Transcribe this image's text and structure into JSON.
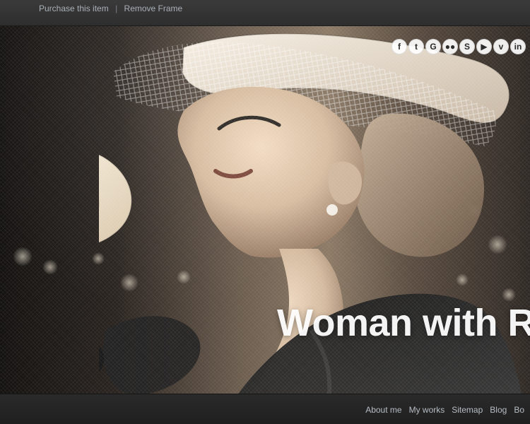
{
  "topbar": {
    "links": [
      {
        "label": "Purchase this item"
      },
      {
        "label": "Remove Frame"
      }
    ],
    "separator": "|"
  },
  "hero": {
    "title": "Woman with Rose",
    "social": [
      {
        "icon": "facebook-icon",
        "glyph": "f"
      },
      {
        "icon": "twitter-icon",
        "glyph": "t"
      },
      {
        "icon": "google-plus-icon",
        "glyph": "G"
      },
      {
        "icon": "flickr-icon",
        "glyph": "●●"
      },
      {
        "icon": "skype-icon",
        "glyph": "S"
      },
      {
        "icon": "youtube-icon",
        "glyph": "▶"
      },
      {
        "icon": "vimeo-icon",
        "glyph": "v"
      },
      {
        "icon": "linkedin-icon",
        "glyph": "in"
      }
    ]
  },
  "bottombar": {
    "nav": [
      {
        "label": "About me"
      },
      {
        "label": "My works"
      },
      {
        "label": "Sitemap"
      },
      {
        "label": "Blog"
      },
      {
        "label": "Bo"
      }
    ]
  }
}
